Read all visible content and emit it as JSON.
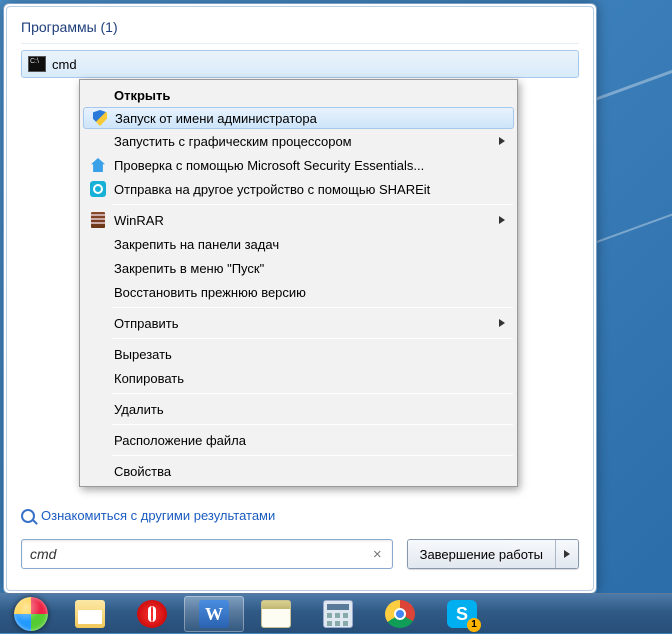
{
  "section": {
    "header": "Программы (1)"
  },
  "result": {
    "label": "cmd"
  },
  "context": {
    "open": "Открыть",
    "run_as_admin": "Запуск от имени администратора",
    "run_gpu": "Запустить с графическим процессором",
    "mse_scan": "Проверка с помощью Microsoft Security Essentials...",
    "shareit": "Отправка на другое устройство с помощью SHAREit",
    "winrar": "WinRAR",
    "pin_taskbar": "Закрепить на панели задач",
    "pin_start": "Закрепить в меню \"Пуск\"",
    "restore_prev": "Восстановить прежнюю версию",
    "send_to": "Отправить",
    "cut": "Вырезать",
    "copy": "Копировать",
    "delete": "Удалить",
    "file_location": "Расположение файла",
    "properties": "Свойства"
  },
  "see_more": "Ознакомиться с другими результатами",
  "search": {
    "value": "cmd"
  },
  "shutdown": {
    "label": "Завершение работы"
  },
  "skype_badge": "1"
}
